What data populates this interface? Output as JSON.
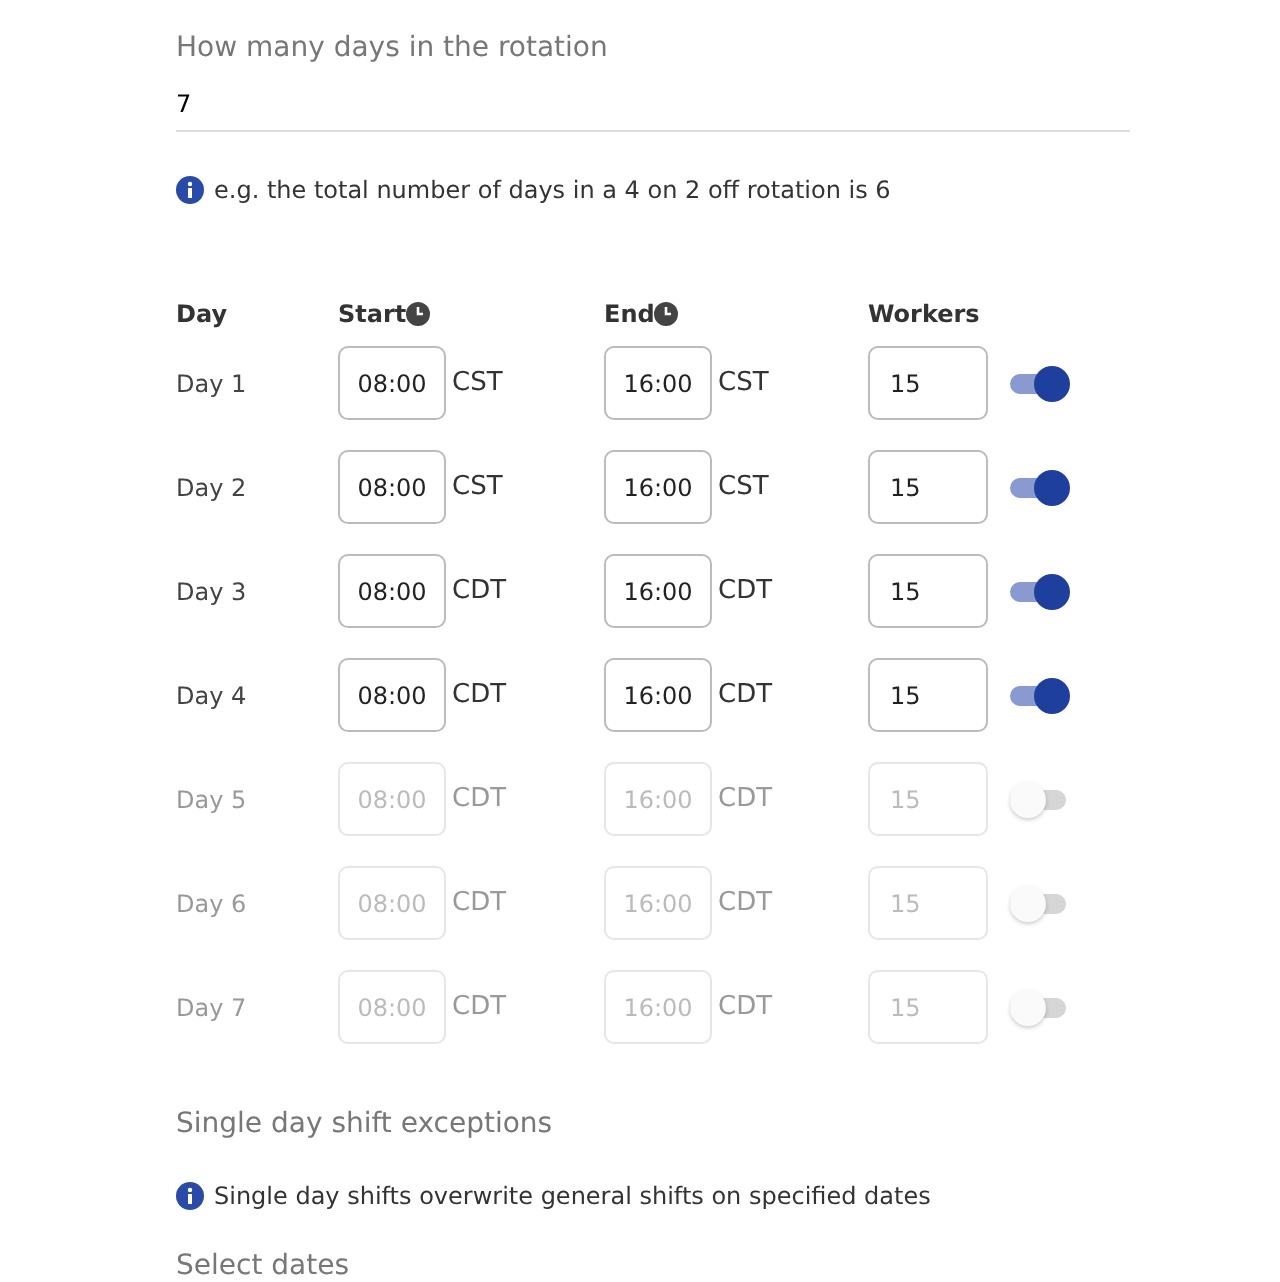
{
  "rotation_field": {
    "label": "How many days in the rotation",
    "value": "7"
  },
  "rotation_hint": "e.g. the total number of days in a 4 on 2 off rotation is 6",
  "columns": [
    "Day",
    "Start",
    "End",
    "Workers"
  ],
  "days": [
    {
      "label": "Day 1",
      "start": "08:00",
      "start_zone": "CST",
      "end": "16:00",
      "end_zone": "CST",
      "workers": "15",
      "on": true
    },
    {
      "label": "Day 2",
      "start": "08:00",
      "start_zone": "CST",
      "end": "16:00",
      "end_zone": "CST",
      "workers": "15",
      "on": true
    },
    {
      "label": "Day 3",
      "start": "08:00",
      "start_zone": "CDT",
      "end": "16:00",
      "end_zone": "CDT",
      "workers": "15",
      "on": true
    },
    {
      "label": "Day 4",
      "start": "08:00",
      "start_zone": "CDT",
      "end": "16:00",
      "end_zone": "CDT",
      "workers": "15",
      "on": true
    },
    {
      "label": "Day 5",
      "start": "08:00",
      "start_zone": "CDT",
      "end": "16:00",
      "end_zone": "CDT",
      "workers": "15",
      "on": false
    },
    {
      "label": "Day 6",
      "start": "08:00",
      "start_zone": "CDT",
      "end": "16:00",
      "end_zone": "CDT",
      "workers": "15",
      "on": false
    },
    {
      "label": "Day 7",
      "start": "08:00",
      "start_zone": "CDT",
      "end": "16:00",
      "end_zone": "CDT",
      "workers": "15",
      "on": false
    }
  ],
  "exceptions": {
    "title": "Single day shift exceptions",
    "hint": "Single day shifts overwrite general shifts on specified dates",
    "select_label": "Select dates"
  }
}
